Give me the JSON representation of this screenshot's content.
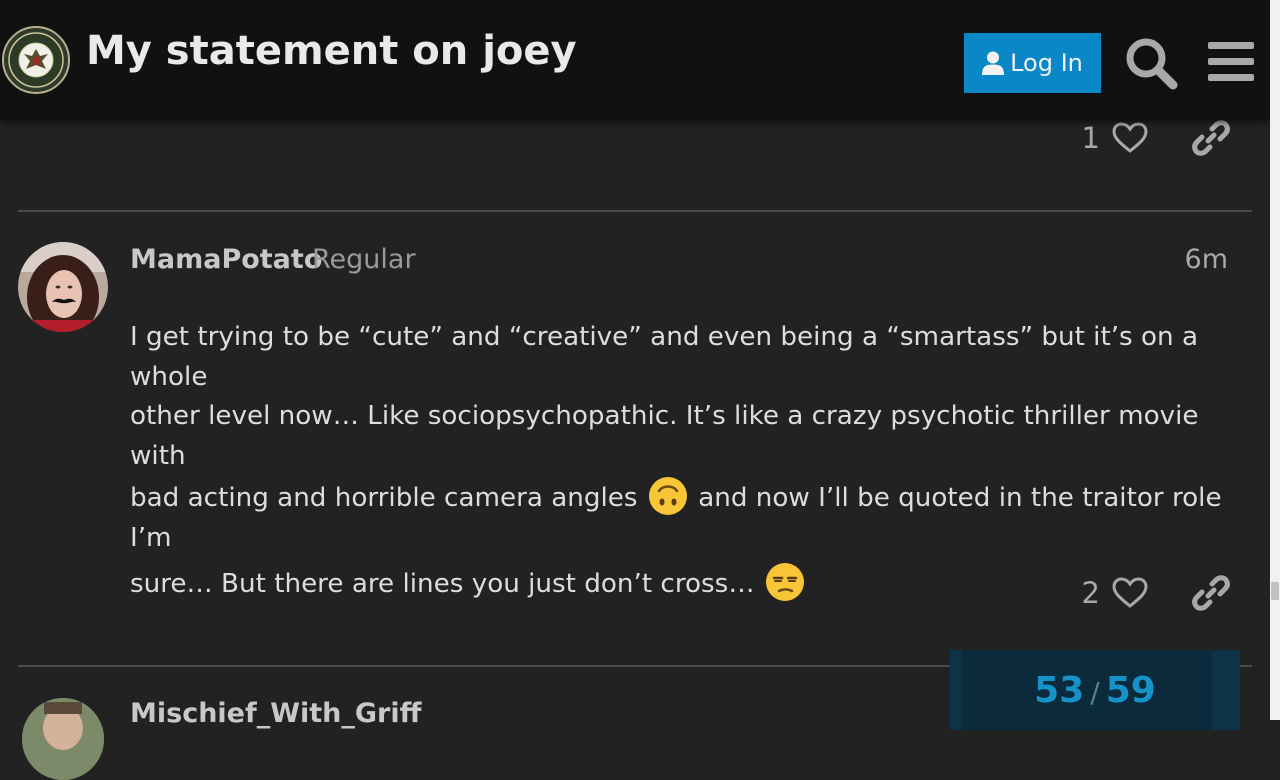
{
  "header": {
    "title": "My statement on joey",
    "login_label": "Log In"
  },
  "previous_post": {
    "like_count": "1"
  },
  "post": {
    "username": "MamaPotato",
    "user_title": "Regular",
    "date": "6m",
    "body": {
      "line1": "I get trying to be “cute” and “creative” and even being a “smartass” but it’s on a whole",
      "line2": "other level now… Like sociopsychopathic. It’s like a crazy psychotic thriller movie with",
      "line3a": "bad acting and horrible camera angles",
      "line3b": "and now I’ll be quoted in the traitor role I’m",
      "line4": "sure… But there are lines you just don’t cross…"
    },
    "like_count": "2"
  },
  "next_post": {
    "username": "Mischief_With_Griff"
  },
  "timeline": {
    "current": "53",
    "separator": "/",
    "total": "59"
  },
  "icons": {
    "logo": "infowars-army-seal-icon",
    "login": "user-icon",
    "search": "search-icon",
    "menu": "hamburger-icon",
    "like": "heart-icon",
    "share": "link-icon",
    "emoji1": "upside-down-face-icon",
    "emoji2": "unamused-face-icon"
  },
  "colors": {
    "background": "#222222",
    "header": "#111111",
    "accent": "#0a87c6",
    "timeline": "#1593c9"
  }
}
